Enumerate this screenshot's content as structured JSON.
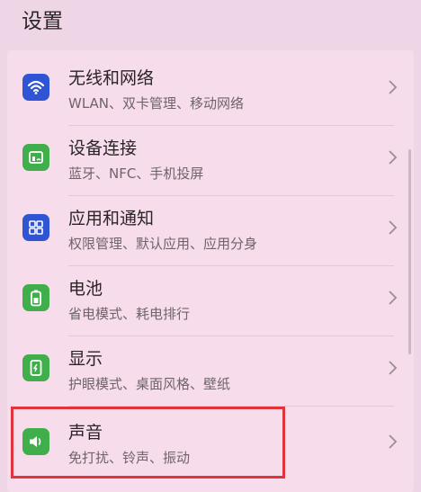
{
  "header": {
    "title": "设置"
  },
  "items": [
    {
      "title": "无线和网络",
      "subtitle": "WLAN、双卡管理、移动网络",
      "icon": "wifi-icon",
      "icon_color": "#2f55d4"
    },
    {
      "title": "设备连接",
      "subtitle": "蓝牙、NFC、手机投屏",
      "icon": "device-connection-icon",
      "icon_color": "#3fae4b"
    },
    {
      "title": "应用和通知",
      "subtitle": "权限管理、默认应用、应用分身",
      "icon": "apps-grid-icon",
      "icon_color": "#2f55d4"
    },
    {
      "title": "电池",
      "subtitle": "省电模式、耗电排行",
      "icon": "battery-icon",
      "icon_color": "#3fae4b"
    },
    {
      "title": "显示",
      "subtitle": "护眼模式、桌面风格、壁纸",
      "icon": "display-icon",
      "icon_color": "#3fae4b"
    },
    {
      "title": "声音",
      "subtitle": "免打扰、铃声、振动",
      "icon": "speaker-icon",
      "icon_color": "#3fae4b"
    }
  ],
  "highlight_color": "#e0333b"
}
